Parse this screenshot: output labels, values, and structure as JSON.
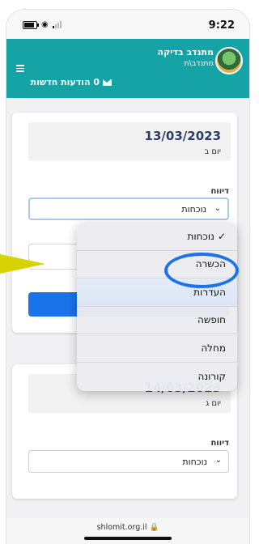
{
  "status": {
    "time": "9:22"
  },
  "header": {
    "user_name": "מתנדב בדיקה",
    "user_role": "מתנדב\\ת",
    "messages": "0 הודעות חדשות"
  },
  "card1": {
    "date": "13/03/2023",
    "weekday": "יום ב",
    "report_label": "דיווח",
    "report_value": "נוכחות"
  },
  "card2": {
    "date": "14/03/2023",
    "weekday": "יום ג",
    "report_label": "דיווח",
    "report_value": "נוכחות"
  },
  "dropdown": {
    "options": [
      "נוכחות",
      "הכשרה",
      "העדרות",
      "חופשה",
      "מחלה",
      "קורונה"
    ],
    "selected": "נוכחות",
    "check": "✓"
  },
  "footer": {
    "domain": "shlomit.org.il 🔒"
  },
  "colors": {
    "header": "#16a3a6",
    "accent": "#1a73e8",
    "annotation_arrow": "#d7d200"
  }
}
